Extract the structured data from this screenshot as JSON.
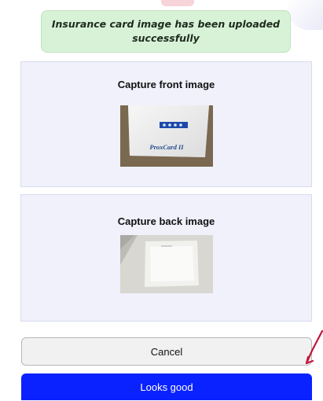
{
  "toast": {
    "message": "Insurance card image has been uploaded successfully"
  },
  "front_section": {
    "title": "Capture front image"
  },
  "back_section": {
    "title": "Capture back image"
  },
  "front_thumbnail": {
    "card_text": "ProxCard II"
  },
  "actions": {
    "cancel_label": "Cancel",
    "confirm_label": "Looks good"
  },
  "colors": {
    "success_bg": "#d8f2d7",
    "panel_bg": "#f0f1fb",
    "primary": "#0a22ff",
    "annotation_arrow": "#c0183c"
  }
}
